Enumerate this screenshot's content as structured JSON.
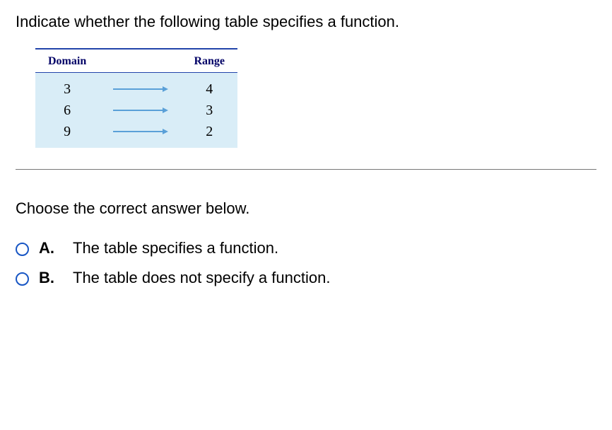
{
  "question": "Indicate whether the following table specifies a function.",
  "table": {
    "domain_header": "Domain",
    "range_header": "Range",
    "rows": [
      {
        "domain": "3",
        "range": "4"
      },
      {
        "domain": "6",
        "range": "3"
      },
      {
        "domain": "9",
        "range": "2"
      }
    ]
  },
  "prompt": "Choose the correct answer below.",
  "choices": [
    {
      "letter": "A.",
      "text": "The table specifies a function."
    },
    {
      "letter": "B.",
      "text": "The table does not specify a function."
    }
  ]
}
